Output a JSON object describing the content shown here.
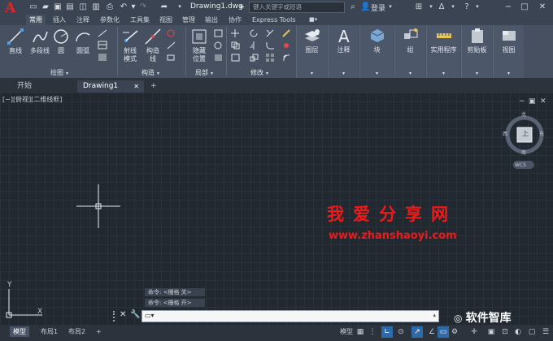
{
  "title_bar": {
    "document_title": "Drawing1.dwg",
    "search_placeholder": "键入关键字或短语",
    "login_label": "登录"
  },
  "ribbon_tabs": [
    "常用",
    "插入",
    "注释",
    "参数化",
    "工具集",
    "视图",
    "管理",
    "输出",
    "协作",
    "Express Tools"
  ],
  "ribbon": {
    "draw": {
      "tools": [
        "直线",
        "多段线",
        "圆",
        "圆弧"
      ],
      "title": "绘图"
    },
    "construct": {
      "tools": [
        "射线\n模式",
        "构造\n线"
      ],
      "title": "构造"
    },
    "part": {
      "tools": [
        "隐藏\n位置"
      ],
      "title": "局部"
    },
    "modify": {
      "title": "修改"
    },
    "big_tools": [
      "图层",
      "注释",
      "块",
      "组",
      "实用程序",
      "剪贴板",
      "视图"
    ]
  },
  "file_tabs": {
    "start": "开始",
    "drawing": "Drawing1",
    "add": "+"
  },
  "canvas": {
    "view_label": "[−][俯视][二维线框]",
    "compass": {
      "north": "北",
      "south": "南",
      "east": "东",
      "west": "西",
      "top": "上",
      "wcs": "WCS"
    },
    "ucs": {
      "y": "Y",
      "x": "X"
    },
    "command_history": [
      "命令: <栅格 关>",
      "命令: <栅格 开>"
    ],
    "watermark_cn": "我爱分享网",
    "watermark_url": "www.zhanshaoyi.com"
  },
  "status": {
    "layouts": [
      "模型",
      "布局1",
      "布局2"
    ],
    "model_label": "模型",
    "wechat_label": "软件智库"
  },
  "colors": {
    "accent": "#2f6aa8",
    "logo": "#e0252c",
    "watermark": "#ee1a1a"
  }
}
